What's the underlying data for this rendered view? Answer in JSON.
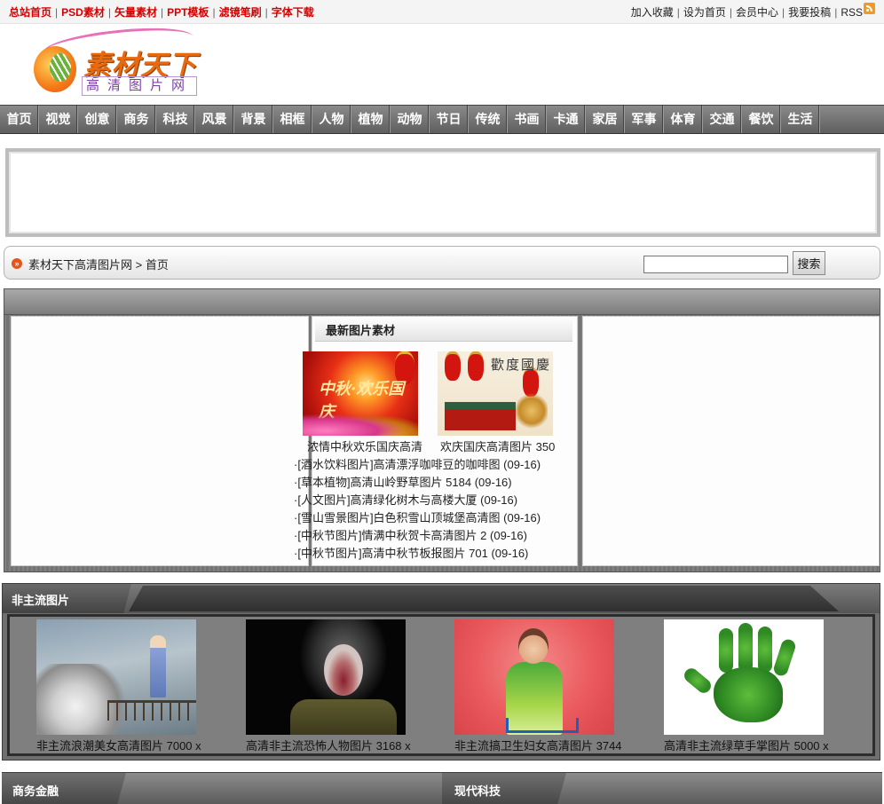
{
  "top_links": [
    "总站首页",
    "PSD素材",
    "矢量素材",
    "PPT模板",
    "滤镜笔刷",
    "字体下载"
  ],
  "right_links": [
    "加入收藏",
    "设为首页",
    "会员中心",
    "我要投稿",
    "RSS"
  ],
  "logo": {
    "title": "素材天下",
    "subtitle": "高清图片网"
  },
  "nav": [
    "首页",
    "视觉",
    "创意",
    "商务",
    "科技",
    "风景",
    "背景",
    "相框",
    "人物",
    "植物",
    "动物",
    "节日",
    "传统",
    "书画",
    "卡通",
    "家居",
    "军事",
    "体育",
    "交通",
    "餐饮",
    "生活"
  ],
  "breadcrumb": {
    "site": "素材天下高清图片网",
    "separator": ">",
    "current": "首页"
  },
  "search": {
    "value": "",
    "button": "搜索"
  },
  "latest": {
    "title": "最新图片素材",
    "thumbs": [
      {
        "caption": "浓情中秋欢乐国庆高清",
        "art_text": "中秋·欢乐国庆"
      },
      {
        "caption": "欢庆国庆高清图片 350",
        "art_text": "歡度國慶"
      }
    ],
    "items": [
      "·[酒水饮料图片]高清漂浮咖啡豆的咖啡图 (09-16)",
      "·[草本植物]高清山岭野草图片 5184 (09-16)",
      "·[人文图片]高清绿化树木与高楼大厦 (09-16)",
      "·[雪山雪景图片]白色积雪山顶城堡高清图 (09-16)",
      "·[中秋节图片]情满中秋贺卡高清图片 2 (09-16)",
      "·[中秋节图片]高清中秋节板报图片 701 (09-16)"
    ]
  },
  "feature": {
    "title": "非主流图片",
    "items": [
      "非主流浪潮美女高清图片 7000 x",
      "高清非主流恐怖人物图片 3168 x",
      "非主流搞卫生妇女高清图片 3744",
      "高清非主流绿草手掌图片 5000 x"
    ]
  },
  "bottom_sections": [
    "商务金融",
    "现代科技"
  ]
}
